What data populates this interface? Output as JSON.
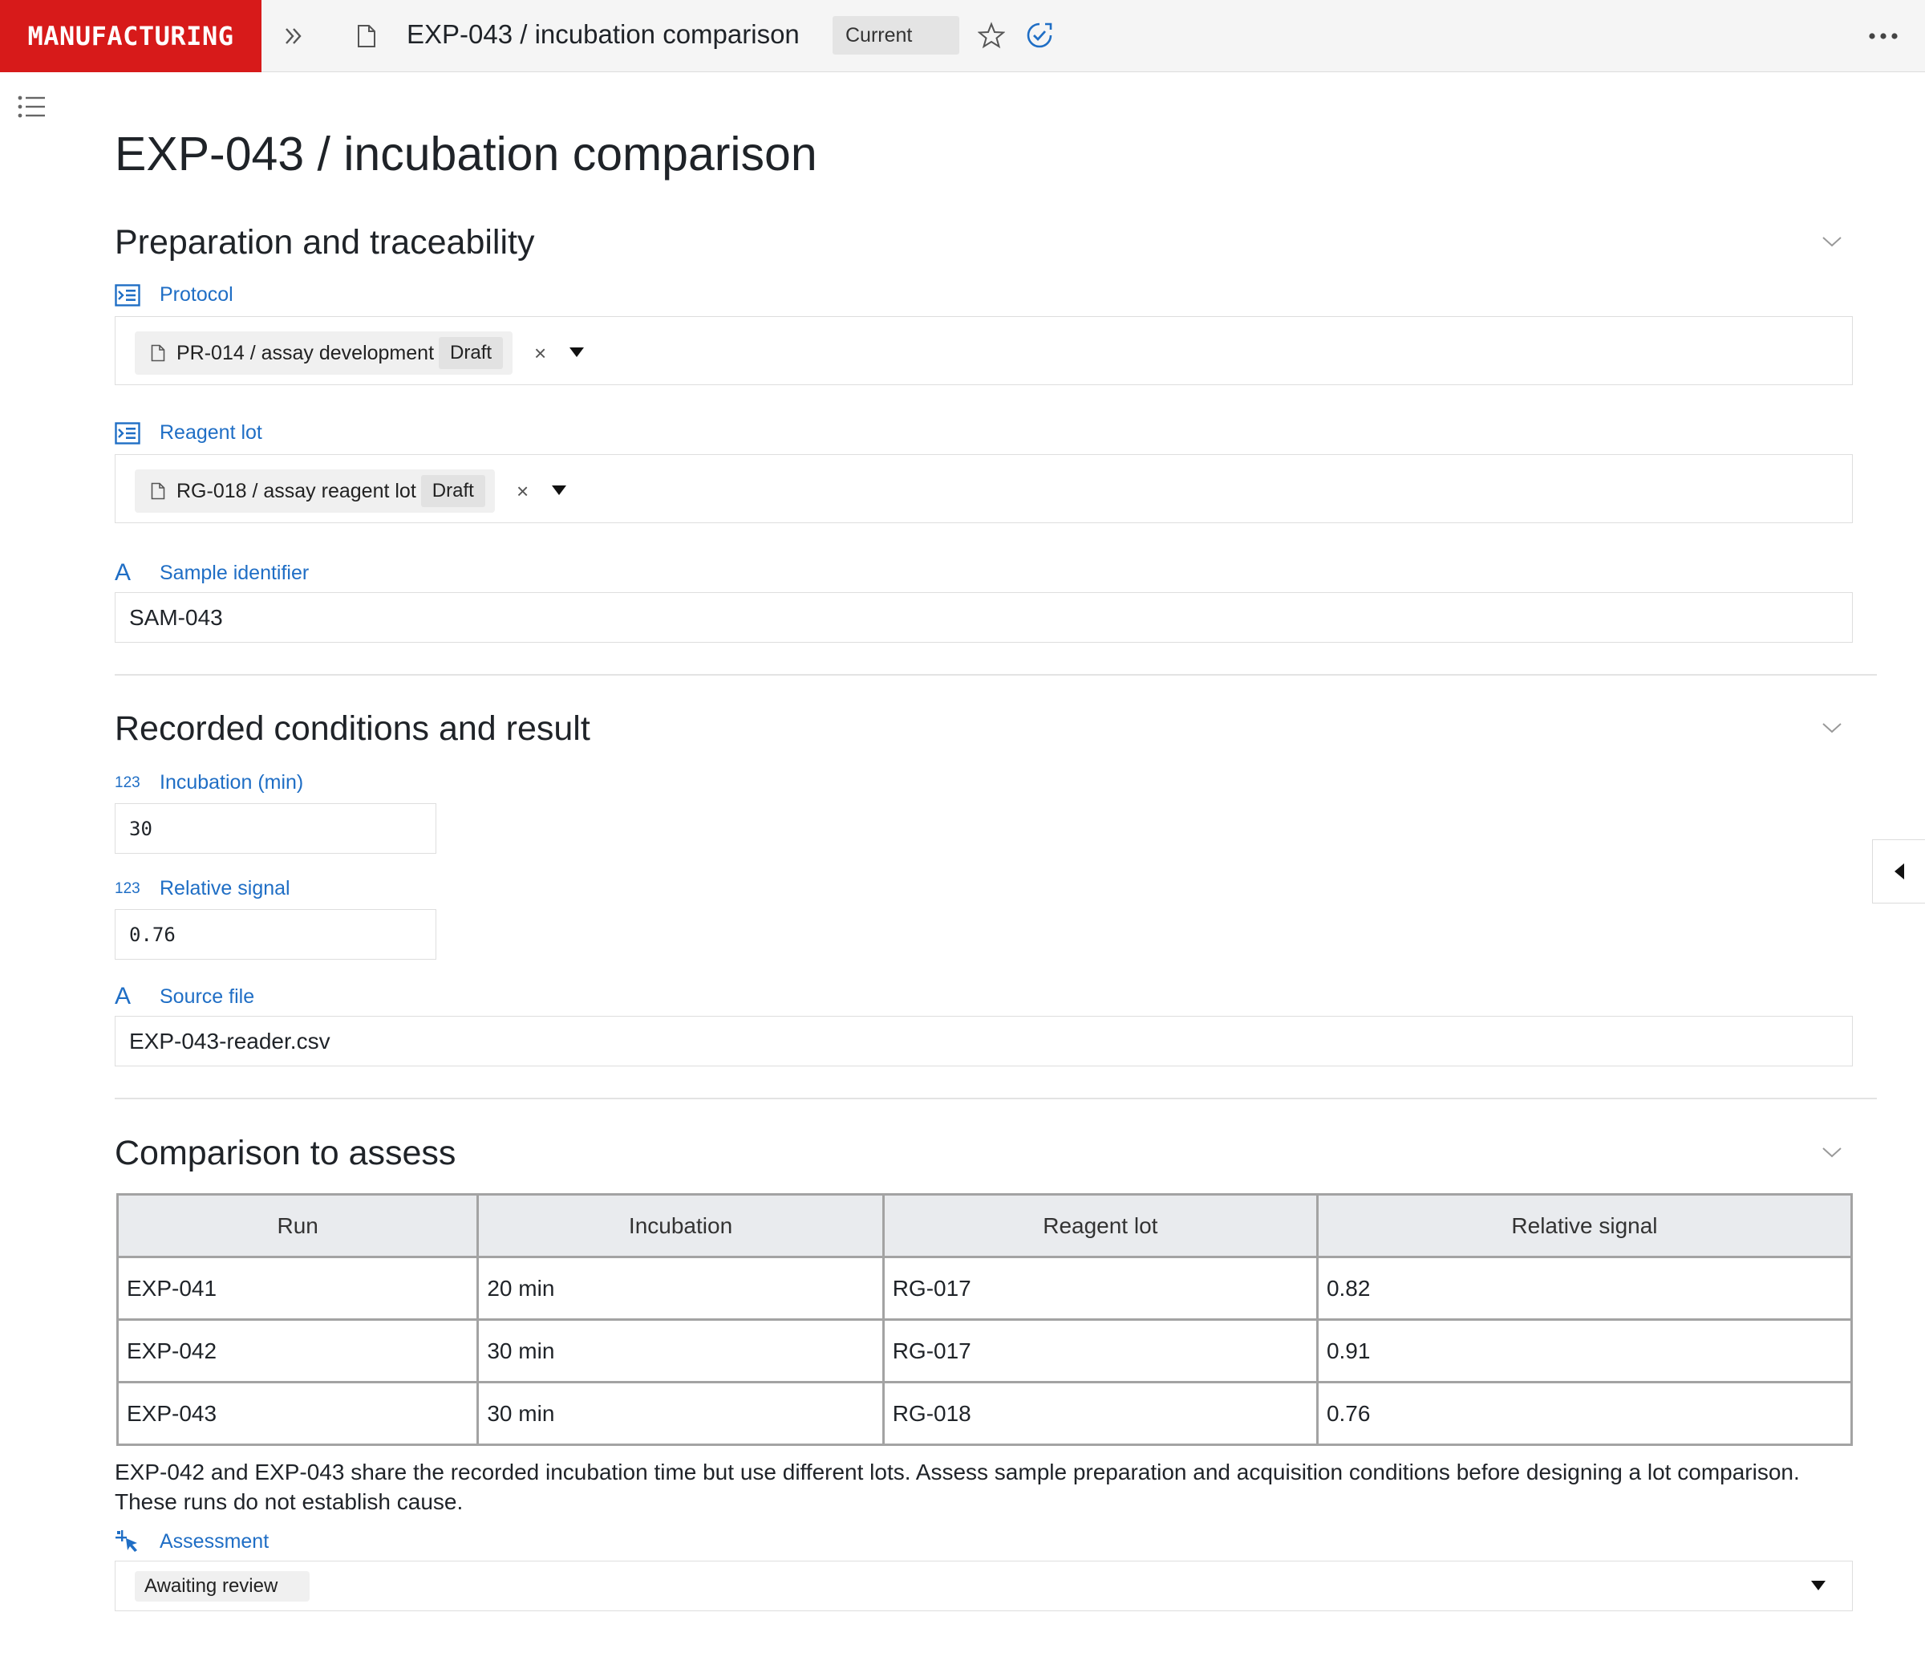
{
  "brand": "MANUFACTURING",
  "header": {
    "title": "EXP-043 / incubation comparison",
    "status_badge": "Current",
    "icons": [
      "double-chevron-right-icon",
      "document-icon",
      "star-icon",
      "verified-check-icon",
      "more-icon"
    ]
  },
  "page": {
    "title": "EXP-043 / incubation comparison"
  },
  "sections": {
    "preparation": {
      "title": "Preparation and traceability",
      "protocol": {
        "label": "Protocol",
        "value": "PR-014 / assay development",
        "badge": "Draft"
      },
      "reagent_lot": {
        "label": "Reagent lot",
        "value": "RG-018 / assay reagent lot",
        "badge": "Draft"
      },
      "sample_identifier": {
        "label": "Sample identifier",
        "value": "SAM-043"
      }
    },
    "conditions": {
      "title": "Recorded conditions and result",
      "incubation": {
        "icon_text": "123",
        "label": "Incubation (min)",
        "value": "30"
      },
      "relative_signal": {
        "icon_text": "123",
        "label": "Relative signal",
        "value": "0.76"
      },
      "source_file": {
        "label": "Source file",
        "value": "EXP-043-reader.csv"
      }
    },
    "comparison": {
      "title": "Comparison to assess",
      "columns": [
        "Run",
        "Incubation",
        "Reagent lot",
        "Relative signal"
      ],
      "rows": [
        [
          "EXP-041",
          "20 min",
          "RG-017",
          "0.82"
        ],
        [
          "EXP-042",
          "30 min",
          "RG-017",
          "0.91"
        ],
        [
          "EXP-043",
          "30 min",
          "RG-018",
          "0.76"
        ]
      ],
      "note": "EXP-042 and EXP-043 share the recorded incubation time but use different lots. Assess sample preparation and acquisition conditions before designing a lot comparison. These runs do not establish cause.",
      "assessment": {
        "label": "Assessment",
        "value": "Awaiting review"
      }
    }
  },
  "glyphs": {
    "text_field_icon": "A",
    "clear": "×"
  },
  "colors": {
    "brand": "#d71a1a",
    "accent": "#1f6ec5"
  }
}
